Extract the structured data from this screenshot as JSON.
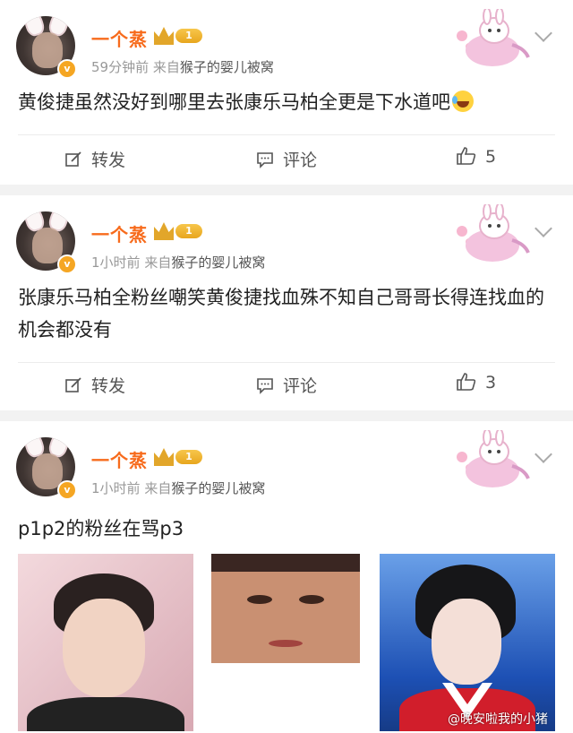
{
  "posts": [
    {
      "username": "一个蒸",
      "level": "1",
      "verified_mark": "v",
      "time": "59分钟前",
      "from_label": "来自",
      "source": "猴子的婴儿被窝",
      "text": "黄俊捷虽然没好到哪里去张康乐马柏全更是下水道吧",
      "actions": {
        "share": "转发",
        "comment": "评论",
        "like": "5"
      }
    },
    {
      "username": "一个蒸",
      "level": "1",
      "verified_mark": "v",
      "time": "1小时前",
      "from_label": "来自",
      "source": "猴子的婴儿被窝",
      "text": "张康乐马柏全粉丝嘲笑黄俊捷找血殊不知自己哥哥长得连找血的机会都没有",
      "actions": {
        "share": "转发",
        "comment": "评论",
        "like": "3"
      }
    },
    {
      "username": "一个蒸",
      "level": "1",
      "verified_mark": "v",
      "time": "1小时前",
      "from_label": "来自",
      "source": "猴子的婴儿被窝",
      "text": "p1p2的粉丝在骂p3"
    }
  ],
  "watermark": "@晚安啦我的小猪",
  "icons": {
    "share": "share-edit-icon",
    "comment": "comment-bubble-icon",
    "like": "thumbs-up-icon",
    "more": "chevron-down-icon",
    "laugh": "laughing-tears-emoji",
    "crown": "crown-icon"
  },
  "colors": {
    "username": "#f76b1c",
    "meta": "#999999",
    "level_badge": "#f0b43a",
    "verified_badge": "#f5a623",
    "background": "#f2f2f2"
  }
}
